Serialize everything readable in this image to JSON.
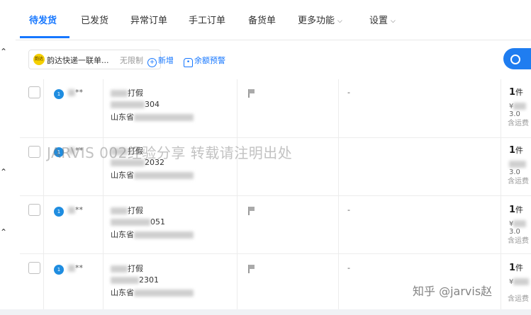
{
  "tabs": [
    {
      "label": "待发货"
    },
    {
      "label": "已发货"
    },
    {
      "label": "异常订单"
    },
    {
      "label": "手工订单"
    },
    {
      "label": "备货单"
    },
    {
      "label": "更多功能"
    },
    {
      "label": "设置"
    }
  ],
  "toolbar": {
    "carrier_name": "韵达快递一联单...",
    "carrier_limit": "无限制",
    "add_label": "新增",
    "balance_alert_label": "余额预警"
  },
  "rows": [
    {
      "buyer_suffix": "**",
      "name_suffix": "打假",
      "phone_suffix": "304",
      "address_prefix": "山东省",
      "dash": "-",
      "qty_num": "1",
      "qty_unit": "件",
      "price_prefix": "¥",
      "price_suffix": "3.0",
      "ship_label": "含运费"
    },
    {
      "buyer_suffix": "**",
      "name_suffix": "打假",
      "phone_suffix": "2032",
      "address_prefix": "山东省",
      "dash": "",
      "qty_num": "1",
      "qty_unit": "件",
      "price_prefix": "",
      "price_suffix": "3.0",
      "ship_label": "含运费"
    },
    {
      "buyer_suffix": "**",
      "name_suffix": "打假",
      "phone_suffix": "051",
      "address_prefix": "山东省",
      "dash": "-",
      "qty_num": "1",
      "qty_unit": "件",
      "price_prefix": "¥",
      "price_suffix": "3.0",
      "ship_label": "含运费"
    },
    {
      "buyer_suffix": "**",
      "name_suffix": "打假",
      "phone_suffix": "2301",
      "address_prefix": "山东省",
      "dash": "-",
      "qty_num": "1",
      "qty_unit": "件",
      "price_prefix": "¥",
      "price_suffix": "",
      "ship_label": "含运费"
    }
  ],
  "watermark": "JARVIS 002经验分享 转载请注明出处",
  "credit": "知乎 @jarvis赵",
  "colors": {
    "accent": "#1677ff",
    "avatar": "#1f8de0",
    "button": "#1f7df0"
  }
}
